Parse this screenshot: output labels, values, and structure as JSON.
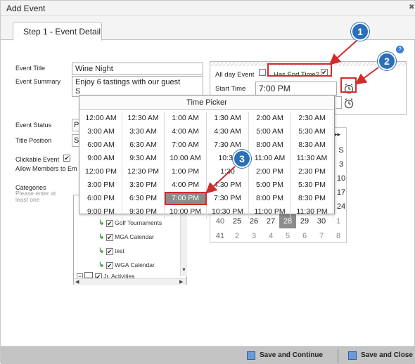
{
  "window": {
    "title": "Add Event"
  },
  "tabs": [
    {
      "label": "Step 1 - Event Detail"
    }
  ],
  "form": {
    "event_title_label": "Event Title",
    "event_title_value": "Wine Night",
    "event_summary_label": "Event Summary",
    "event_summary_line1": "Enjoy 6 tastings with our guest",
    "event_summary_line2": "S",
    "event_status_label": "Event Status",
    "event_status_value": "P",
    "title_position_label": "Title Position",
    "title_position_value": "S",
    "clickable_event_label": "Clickable Event",
    "allow_members_label": "Allow Members to Em",
    "categories_label": "Categories",
    "categories_hint_line1": "Please enter at",
    "categories_hint_line2": "least one"
  },
  "time_panel": {
    "all_day_label": "All day Event",
    "all_day_checked": false,
    "has_end_time_label": "Has End Time?",
    "has_end_time_checked": true,
    "start_time_label": "Start Time",
    "start_time_value": "7:00 PM"
  },
  "time_picker": {
    "title": "Time Picker",
    "selected": "7:00 PM",
    "times": [
      [
        "12:00 AM",
        "12:30 AM",
        "1:00 AM",
        "1:30 AM",
        "2:00 AM",
        "2:30 AM"
      ],
      [
        "3:00 AM",
        "3:30 AM",
        "4:00 AM",
        "4:30 AM",
        "5:00 AM",
        "5:30 AM"
      ],
      [
        "6:00 AM",
        "6:30 AM",
        "7:00 AM",
        "7:30 AM",
        "8:00 AM",
        "8:30 AM"
      ],
      [
        "9:00 AM",
        "9:30 AM",
        "10:00 AM",
        "10:30",
        "11:00 AM",
        "11:30 AM"
      ],
      [
        "12:00 PM",
        "12:30 PM",
        "1:00 PM",
        "1:30",
        "2:00 PM",
        "2:30 PM"
      ],
      [
        "3:00 PM",
        "3:30 PM",
        "4:00 PM",
        "4:30 PM",
        "5:00 PM",
        "5:30 PM"
      ],
      [
        "6:00 PM",
        "6:30 PM",
        "7:00 PM",
        "7:30 PM",
        "8:00 PM",
        "8:30 PM"
      ],
      [
        "9:00 PM",
        "9:30 PM",
        "10:00 PM",
        "10:30 PM",
        "11:00 PM",
        "11:30 PM"
      ]
    ]
  },
  "calendar": {
    "next_label": "▸▸",
    "side_values": [
      "S",
      "3",
      "10",
      "17",
      "24"
    ],
    "rows": [
      [
        "40",
        "25",
        "26",
        "27",
        "28",
        "29",
        "30",
        "1"
      ],
      [
        "41",
        "2",
        "3",
        "4",
        "5",
        "6",
        "7",
        "8"
      ]
    ],
    "selected_day": "28"
  },
  "category_tree": {
    "items": [
      {
        "label": "Golf Tournaments",
        "checked": true
      },
      {
        "label": "MGA Calendar",
        "checked": true
      },
      {
        "label": "test",
        "checked": true
      },
      {
        "label": "WGA Calendar",
        "checked": true
      },
      {
        "label": "Jr. Activities",
        "checked": true
      }
    ]
  },
  "footer": {
    "save_continue_label": "Save and Continue",
    "save_close_label": "Save and Close"
  },
  "annotations": {
    "badge1": "1",
    "badge2": "2",
    "badge3": "3"
  },
  "colors": {
    "annotation_blue": "#2b6fb8",
    "annotation_red": "#d02c2c",
    "selected_gray": "#8c8c8c"
  }
}
